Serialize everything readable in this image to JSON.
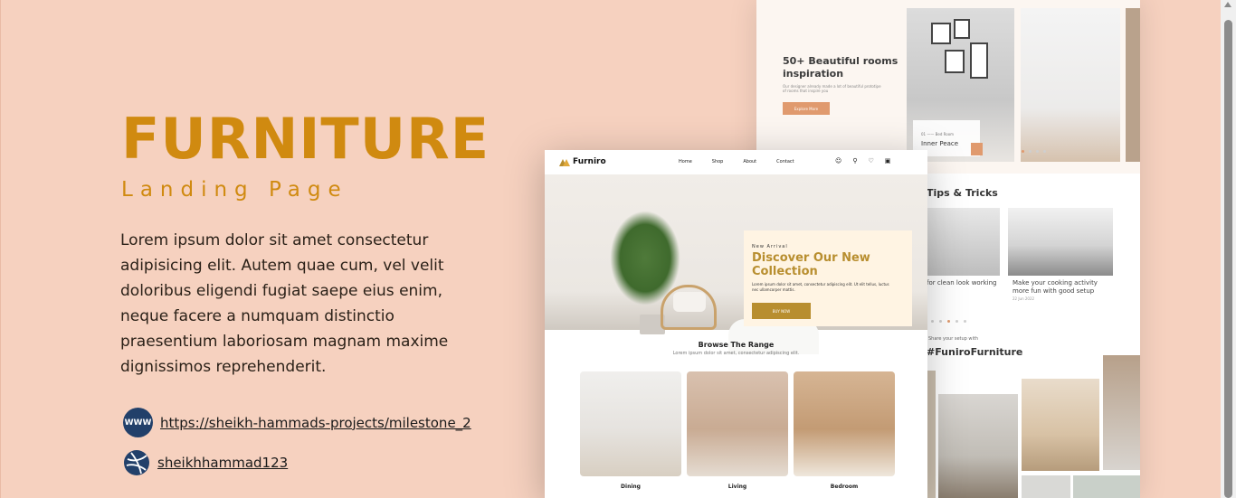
{
  "hero": {
    "title": "FURNITURE",
    "subtitle": "Landing Page",
    "description": "Lorem ipsum dolor sit amet consectetur adipisicing elit. Autem quae cum, vel velit doloribus eligendi fugiat saepe eius enim, neque facere a numquam distinctio praesentium laboriosam magnam maxime dignissimos reprehenderit."
  },
  "links": {
    "website_icon_text": "WWW",
    "website_url": "https://sheikh-hammads-projects/milestone_2",
    "dribbble_handle": "sheikhhammad123"
  },
  "mockup_back": {
    "hero_title": "50+ Beautiful rooms inspiration",
    "hero_text": "Our designer already made a lot of beautiful prototipe of rooms that inspire you",
    "hero_button": "Explore More",
    "card_number": "01",
    "card_category": "Bed Room",
    "card_title": "Inner Peace",
    "tips_title": "Tips & Tricks",
    "tip1_caption": "for clean look working",
    "tip2_caption": "Make your cooking activity more fun with good setup",
    "tip2_date": "22 Jun 2022",
    "share_text": "Share your setup with",
    "brand_tag": "#FuniroFurniture"
  },
  "mockup_front": {
    "logo": "Furniro",
    "menu": [
      "Home",
      "Shop",
      "About",
      "Contact"
    ],
    "card_tag": "New Arrival",
    "card_title": "Discover Our New Collection",
    "card_text": "Lorem ipsum dolor sit amet, consectetur adipiscing elit. Ut elit tellus, luctus nec ullamcorper mattis.",
    "card_button": "BUY NOW",
    "browse_title": "Browse The Range",
    "browse_sub": "Lorem ipsum dolor sit amet, consectetur adipiscing elit.",
    "categories": [
      "Dining",
      "Living",
      "Bedroom"
    ]
  },
  "colors": {
    "background": "#f6d1bf",
    "accent": "#d08a10",
    "brand_gold": "#b88e2f"
  }
}
